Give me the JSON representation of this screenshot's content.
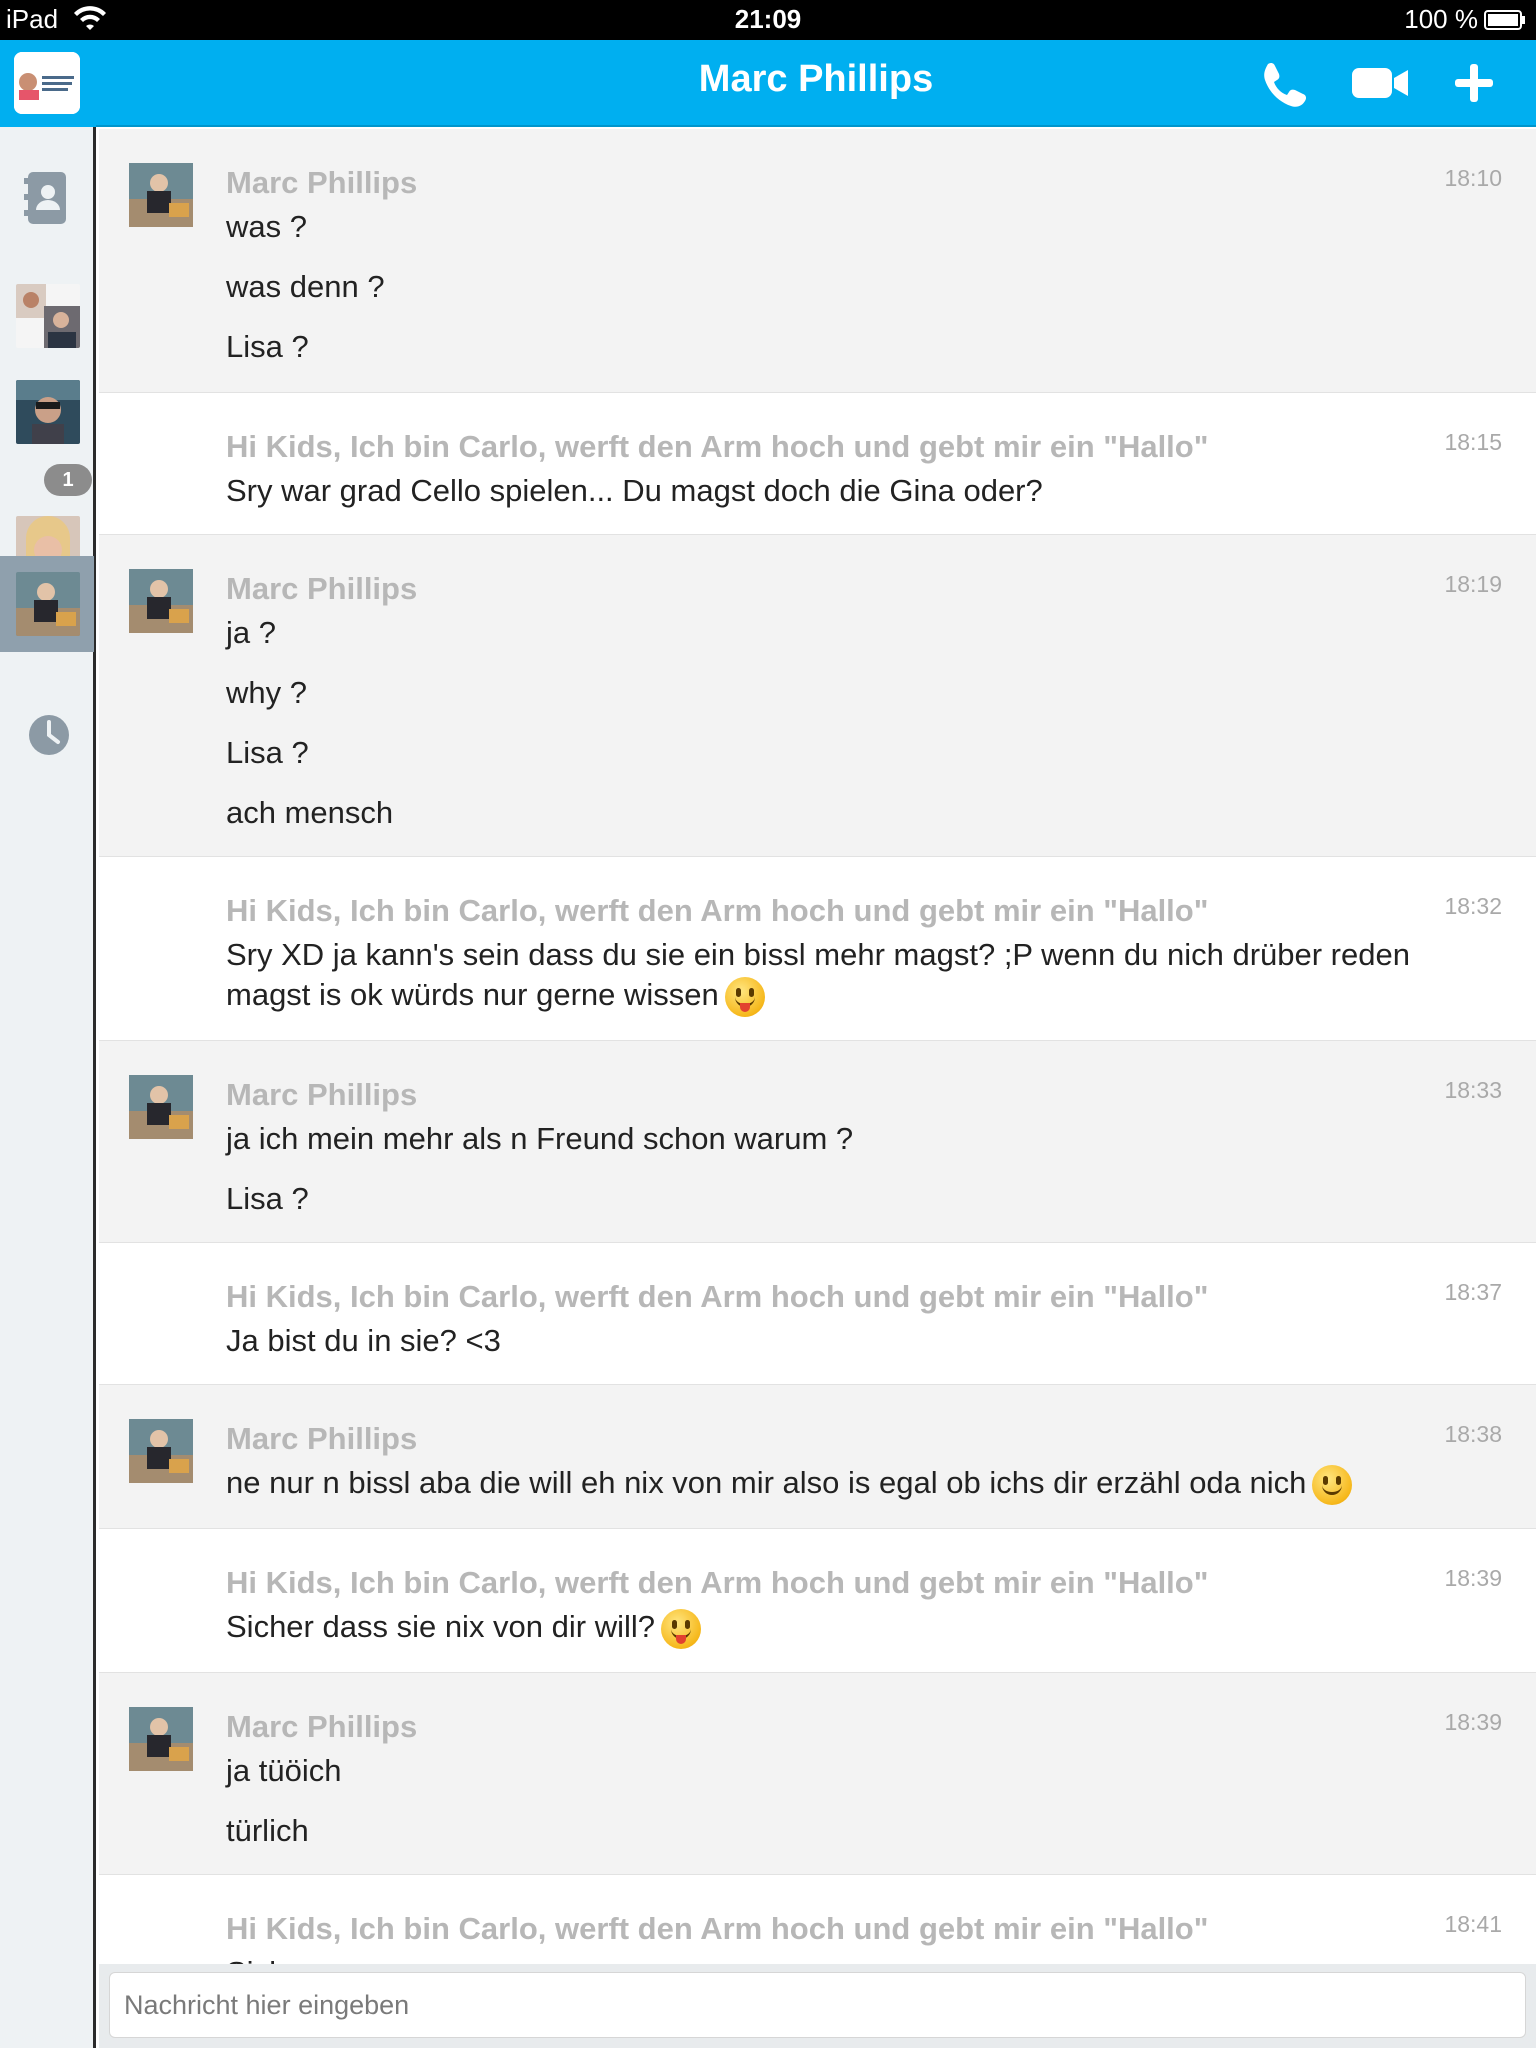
{
  "status_bar": {
    "device": "iPad",
    "time": "21:09",
    "battery": "100 %"
  },
  "header": {
    "title": "Marc Phillips",
    "call_icon": "phone-icon",
    "video_icon": "video-camera-icon",
    "add_icon": "plus-icon"
  },
  "sidebar": {
    "contacts_icon": "contacts-book-icon",
    "recent_icon": "clock-icon",
    "unread_badge": "1"
  },
  "messages": [
    {
      "from": "them",
      "sender": "Marc Phillips",
      "time": "18:10",
      "lines": [
        "was ?",
        "was denn ?",
        "Lisa ?"
      ]
    },
    {
      "from": "me",
      "sender": "Hi Kids, Ich bin Carlo, werft den Arm hoch und gebt mir ein \"Hallo\"",
      "time": "18:15",
      "lines": [
        "Sry war grad Cello spielen... Du magst doch die Gina oder?"
      ]
    },
    {
      "from": "them",
      "sender": "Marc Phillips",
      "time": "18:19",
      "lines": [
        "ja ?",
        "why ?",
        "Lisa ?",
        "ach mensch"
      ]
    },
    {
      "from": "me",
      "sender": "Hi Kids, Ich bin Carlo, werft den Arm hoch und gebt mir ein \"Hallo\"",
      "time": "18:32",
      "lines": [
        "Sry XD ja kann's sein dass du sie ein bissl mehr magst? ;P wenn du nich drüber reden magst is ok würds nur gerne wissen"
      ]
    },
    {
      "from": "them",
      "sender": "Marc Phillips",
      "time": "18:33",
      "lines": [
        "ja ich mein mehr als n Freund schon warum ?",
        "Lisa ?"
      ]
    },
    {
      "from": "me",
      "sender": "Hi Kids, Ich bin Carlo, werft den Arm hoch und gebt mir ein \"Hallo\"",
      "time": "18:37",
      "lines": [
        "Ja bist du in sie? <3"
      ]
    },
    {
      "from": "them",
      "sender": "Marc Phillips",
      "time": "18:38",
      "lines": [
        "ne nur n bissl aba die will eh nix von mir also is egal ob ichs dir erzähl oda nich"
      ]
    },
    {
      "from": "me",
      "sender": "Hi Kids, Ich bin Carlo, werft den Arm hoch und gebt mir ein \"Hallo\"",
      "time": "18:39",
      "lines": [
        "Sicher dass sie nix von dir will?"
      ]
    },
    {
      "from": "them",
      "sender": "Marc Phillips",
      "time": "18:39",
      "lines": [
        "ja tüöich",
        "türlich"
      ]
    },
    {
      "from": "me",
      "sender": "Hi Kids, Ich bin Carlo, werft den Arm hoch und gebt mir ein \"Hallo\"",
      "time": "18:41",
      "lines": [
        "Sicher"
      ]
    }
  ],
  "composer": {
    "placeholder": "Nachricht hier eingeben"
  },
  "colors": {
    "accent": "#00aff0",
    "sidebar_bg": "#eef2f4",
    "them_bg": "#f3f3f3",
    "sender_text": "#b7b7b7"
  }
}
